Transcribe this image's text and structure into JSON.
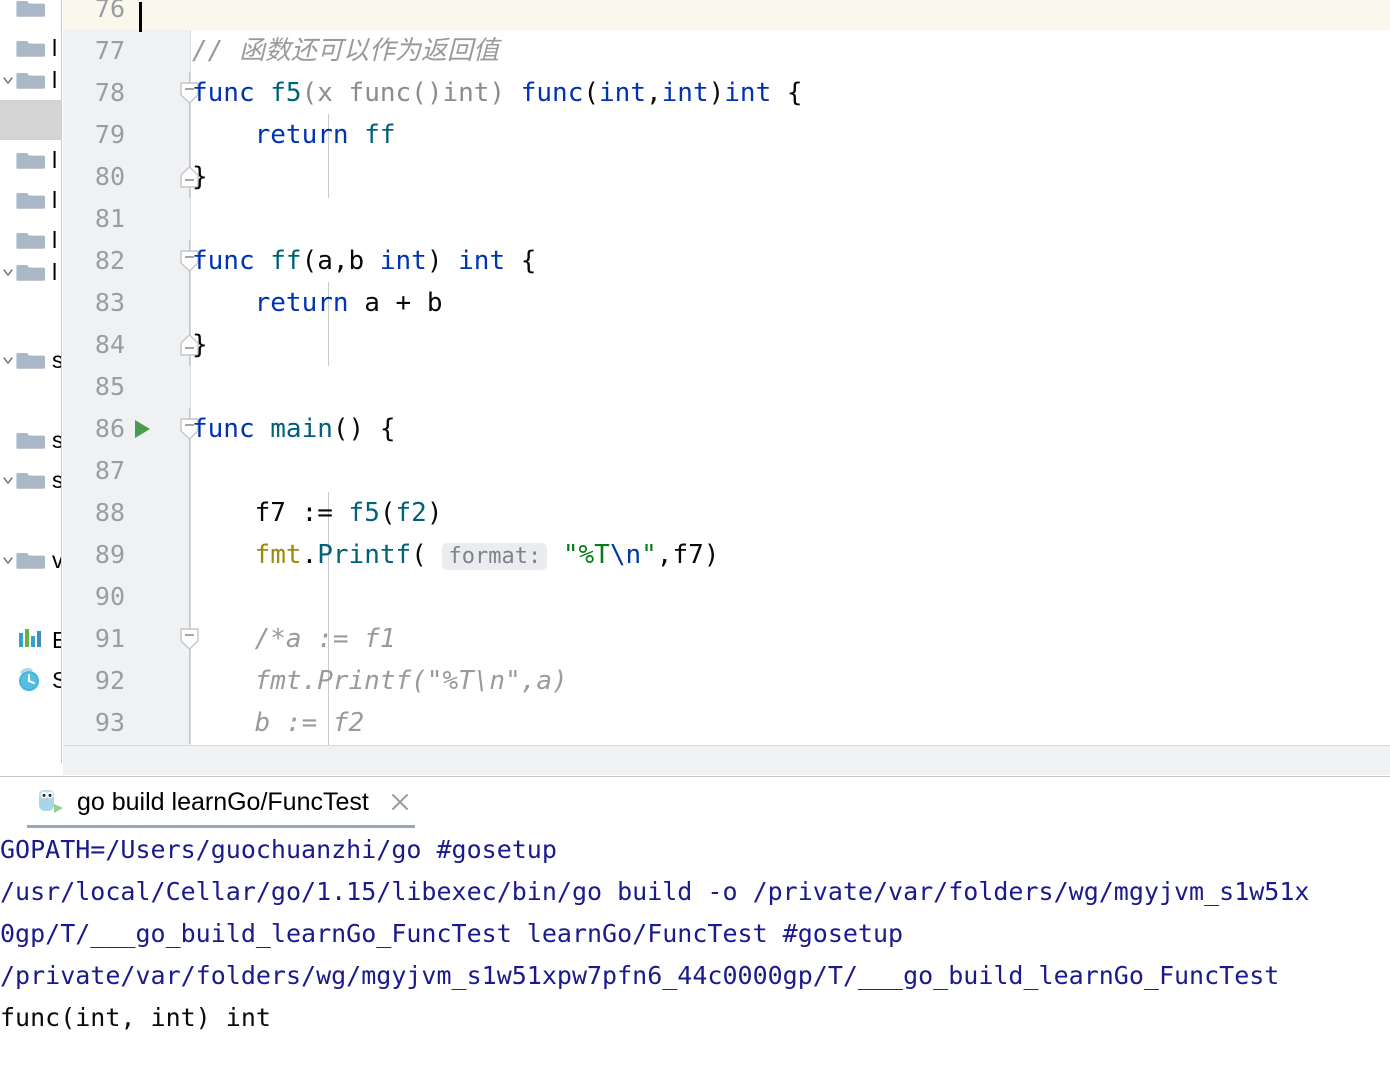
{
  "window": {
    "theme_accent": "#0033b3",
    "editor_background": "#ffffff",
    "gutter_background": "#f0f1f2",
    "current_line_highlight": "#faf8ec",
    "console_text_color": "#1a1a8c"
  },
  "sidebar": {
    "items": [
      {
        "name": "folder-item-1",
        "label": "",
        "icon": "folder-icon",
        "expanded": false,
        "has_chevron": false,
        "selected": false
      },
      {
        "name": "folder-item-2",
        "label": "l",
        "icon": "folder-icon",
        "expanded": false,
        "has_chevron": false,
        "selected": false
      },
      {
        "name": "folder-item-3",
        "label": "l",
        "icon": "folder-icon",
        "expanded": true,
        "has_chevron": true,
        "selected": false
      },
      {
        "name": "folder-item-selected",
        "label": "",
        "icon": "none",
        "expanded": false,
        "has_chevron": false,
        "selected": true
      },
      {
        "name": "folder-item-5",
        "label": "l",
        "icon": "folder-icon",
        "expanded": false,
        "has_chevron": false,
        "selected": false
      },
      {
        "name": "folder-item-6",
        "label": "l",
        "icon": "folder-icon",
        "expanded": false,
        "has_chevron": false,
        "selected": false
      },
      {
        "name": "folder-item-7",
        "label": "l",
        "icon": "folder-icon",
        "expanded": false,
        "has_chevron": false,
        "selected": false
      },
      {
        "name": "folder-item-8",
        "label": "l",
        "icon": "folder-icon",
        "expanded": true,
        "has_chevron": true,
        "selected": false
      },
      {
        "name": "folder-item-9",
        "label": "s",
        "icon": "folder-icon",
        "expanded": true,
        "has_chevron": true,
        "selected": false
      },
      {
        "name": "folder-item-10",
        "label": "s",
        "icon": "folder-icon",
        "expanded": false,
        "has_chevron": false,
        "selected": false
      },
      {
        "name": "folder-item-11",
        "label": "s",
        "icon": "folder-icon",
        "expanded": true,
        "has_chevron": true,
        "selected": false
      },
      {
        "name": "folder-item-12",
        "label": "v",
        "icon": "folder-icon",
        "expanded": true,
        "has_chevron": true,
        "selected": false
      }
    ],
    "external_libraries": {
      "label": "Ext",
      "icon": "library-bars-icon"
    },
    "scratches": {
      "label": "Scr",
      "icon": "clock-icon"
    }
  },
  "editor": {
    "current_line": 76,
    "first_visible_line": 76,
    "lines": [
      {
        "n": 76,
        "current": true,
        "fold": "none",
        "run": false,
        "tokens": []
      },
      {
        "n": 77,
        "current": false,
        "fold": "none",
        "run": false,
        "tokens": [
          {
            "t": "// 函数还可以作为返回值",
            "c": "cmt"
          }
        ]
      },
      {
        "n": 78,
        "current": false,
        "fold": "start",
        "run": false,
        "tokens": [
          {
            "t": "func ",
            "c": "kw"
          },
          {
            "t": "f5",
            "c": "fn"
          },
          {
            "t": "(x func()int)",
            "c": "dim"
          },
          {
            "t": " func",
            "c": "kw"
          },
          {
            "t": "(",
            "c": "plain"
          },
          {
            "t": "int",
            "c": "kw"
          },
          {
            "t": ",",
            "c": "plain"
          },
          {
            "t": "int",
            "c": "kw"
          },
          {
            "t": ")",
            "c": "plain"
          },
          {
            "t": "int",
            "c": "kw"
          },
          {
            "t": " {",
            "c": "plain"
          }
        ]
      },
      {
        "n": 79,
        "current": false,
        "fold": "mid",
        "run": false,
        "tokens": [
          {
            "t": "    ",
            "c": "plain"
          },
          {
            "t": "return ",
            "c": "kw"
          },
          {
            "t": "ff",
            "c": "fn"
          }
        ]
      },
      {
        "n": 80,
        "current": false,
        "fold": "end",
        "run": false,
        "tokens": [
          {
            "t": "}",
            "c": "plain"
          }
        ]
      },
      {
        "n": 81,
        "current": false,
        "fold": "none",
        "run": false,
        "tokens": []
      },
      {
        "n": 82,
        "current": false,
        "fold": "start",
        "run": false,
        "tokens": [
          {
            "t": "func ",
            "c": "kw"
          },
          {
            "t": "ff",
            "c": "fn"
          },
          {
            "t": "(a,b ",
            "c": "plain"
          },
          {
            "t": "int",
            "c": "kw"
          },
          {
            "t": ") ",
            "c": "plain"
          },
          {
            "t": "int",
            "c": "kw"
          },
          {
            "t": " {",
            "c": "plain"
          }
        ]
      },
      {
        "n": 83,
        "current": false,
        "fold": "mid",
        "run": false,
        "tokens": [
          {
            "t": "    ",
            "c": "plain"
          },
          {
            "t": "return ",
            "c": "kw"
          },
          {
            "t": "a + b",
            "c": "plain"
          }
        ]
      },
      {
        "n": 84,
        "current": false,
        "fold": "end",
        "run": false,
        "tokens": [
          {
            "t": "}",
            "c": "plain"
          }
        ]
      },
      {
        "n": 85,
        "current": false,
        "fold": "none",
        "run": false,
        "tokens": []
      },
      {
        "n": 86,
        "current": false,
        "fold": "start",
        "run": true,
        "tokens": [
          {
            "t": "func ",
            "c": "kw"
          },
          {
            "t": "main",
            "c": "fn"
          },
          {
            "t": "() {",
            "c": "plain"
          }
        ]
      },
      {
        "n": 87,
        "current": false,
        "fold": "mid",
        "run": false,
        "tokens": []
      },
      {
        "n": 88,
        "current": false,
        "fold": "mid",
        "run": false,
        "tokens": [
          {
            "t": "    f7 := ",
            "c": "plain"
          },
          {
            "t": "f5",
            "c": "fn"
          },
          {
            "t": "(",
            "c": "plain"
          },
          {
            "t": "f2",
            "c": "fn"
          },
          {
            "t": ")",
            "c": "plain"
          }
        ]
      },
      {
        "n": 89,
        "current": false,
        "fold": "mid",
        "run": false,
        "tokens": [
          {
            "t": "    ",
            "c": "plain"
          },
          {
            "t": "fmt",
            "c": "pkg"
          },
          {
            "t": ".",
            "c": "plain"
          },
          {
            "t": "Printf",
            "c": "fn"
          },
          {
            "t": "( ",
            "c": "plain"
          },
          {
            "t": "format:",
            "c": "hint"
          },
          {
            "t": " ",
            "c": "plain"
          },
          {
            "t": "\"%T",
            "c": "str"
          },
          {
            "t": "\\n",
            "c": "esc"
          },
          {
            "t": "\"",
            "c": "str"
          },
          {
            "t": ",f7)",
            "c": "plain"
          }
        ]
      },
      {
        "n": 90,
        "current": false,
        "fold": "mid",
        "run": false,
        "tokens": []
      },
      {
        "n": 91,
        "current": false,
        "fold": "start",
        "run": false,
        "tokens": [
          {
            "t": "    /*a := f1",
            "c": "cmt"
          }
        ]
      },
      {
        "n": 92,
        "current": false,
        "fold": "mid",
        "run": false,
        "tokens": [
          {
            "t": "    fmt.Printf(\"%T\\n\",a)",
            "c": "cmt"
          }
        ]
      },
      {
        "n": 93,
        "current": false,
        "fold": "mid",
        "run": false,
        "tokens": [
          {
            "t": "    b := f2",
            "c": "cmt"
          }
        ]
      }
    ]
  },
  "run_tool_window": {
    "tab": {
      "label": "go build learnGo/FuncTest",
      "icon": "go-gopher-run-icon",
      "close_icon": "close-icon",
      "active": true
    },
    "console_lines": [
      {
        "text": "GOPATH=/Users/guochuanzhi/go #gosetup",
        "kind": "system"
      },
      {
        "text": "/usr/local/Cellar/go/1.15/libexec/bin/go build -o /private/var/folders/wg/mgyjvm_s1w51x",
        "kind": "system"
      },
      {
        "text": "0gp/T/___go_build_learnGo_FuncTest learnGo/FuncTest #gosetup",
        "kind": "system"
      },
      {
        "text": "/private/var/folders/wg/mgyjvm_s1w51xpw7pfn6_44c0000gp/T/___go_build_learnGo_FuncTest",
        "kind": "system"
      },
      {
        "text": "func(int, int) int",
        "kind": "stdout"
      }
    ]
  }
}
